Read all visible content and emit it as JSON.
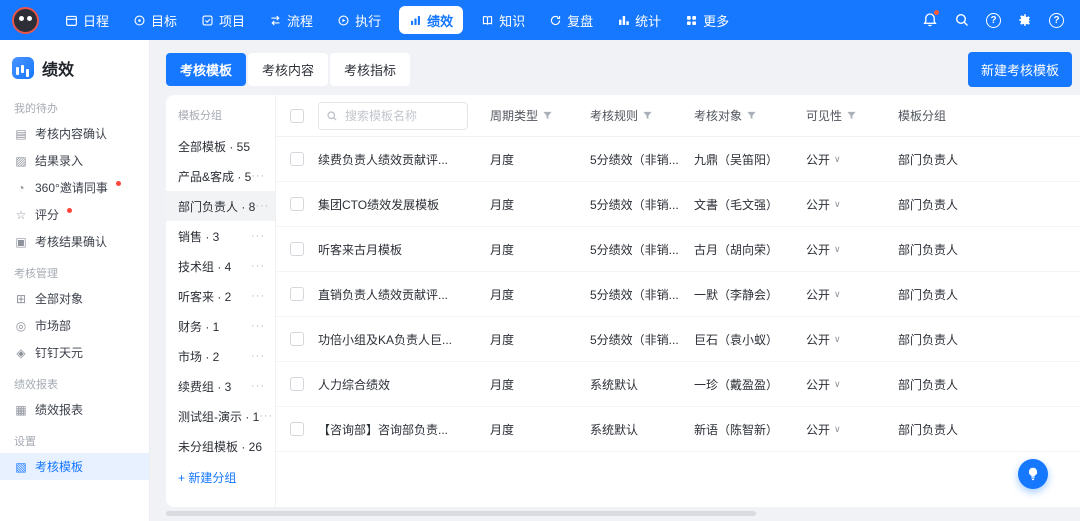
{
  "colors": {
    "accent": "#1677ff",
    "badge": "#ff4438"
  },
  "topbar": {
    "nav_items": [
      {
        "label": "日程",
        "icon": "calendar-icon"
      },
      {
        "label": "目标",
        "icon": "target-icon"
      },
      {
        "label": "项目",
        "icon": "project-icon"
      },
      {
        "label": "流程",
        "icon": "workflow-icon"
      },
      {
        "label": "执行",
        "icon": "execute-icon"
      },
      {
        "label": "绩效",
        "icon": "performance-icon",
        "active": true
      },
      {
        "label": "知识",
        "icon": "knowledge-icon"
      },
      {
        "label": "复盘",
        "icon": "review-icon"
      },
      {
        "label": "统计",
        "icon": "stats-icon"
      },
      {
        "label": "更多",
        "icon": "more-icon"
      }
    ],
    "right_icons": [
      "bell-icon",
      "search-icon",
      "help-icon",
      "settings-icon",
      "question-icon"
    ],
    "help_glyph": "?"
  },
  "sidebar": {
    "title": "绩效",
    "sections": [
      {
        "label": "我的待办",
        "items": [
          {
            "label": "考核内容确认",
            "glyph": "▤"
          },
          {
            "label": "结果录入",
            "glyph": "▨"
          },
          {
            "label": "360°邀请同事",
            "glyph": "◔",
            "dot": true
          },
          {
            "label": "评分",
            "glyph": "☆",
            "dot": true
          },
          {
            "label": "考核结果确认",
            "glyph": "▣"
          }
        ]
      },
      {
        "label": "考核管理",
        "items": [
          {
            "label": "全部对象",
            "glyph": "⊞"
          },
          {
            "label": "市场部",
            "glyph": "◎"
          },
          {
            "label": "钉钉天元",
            "glyph": "◈"
          }
        ]
      },
      {
        "label": "绩效报表",
        "items": [
          {
            "label": "绩效报表",
            "glyph": "▦"
          }
        ]
      },
      {
        "label": "设置",
        "items": [
          {
            "label": "考核模板",
            "glyph": "▧",
            "active": true
          }
        ]
      }
    ]
  },
  "main": {
    "tabs": [
      {
        "label": "考核模板",
        "active": true
      },
      {
        "label": "考核内容"
      },
      {
        "label": "考核指标"
      }
    ],
    "new_template_button": "新建考核模板",
    "groups": {
      "title": "模板分组",
      "more_glyph": "···",
      "new_group": "+ 新建分组",
      "items": [
        {
          "label": "全部模板 · 55"
        },
        {
          "label": "产品&客成 · 5",
          "more": true
        },
        {
          "label": "部门负责人 · 8",
          "more": true,
          "selected": true
        },
        {
          "label": "销售 · 3",
          "more": true
        },
        {
          "label": "技术组 · 4",
          "more": true
        },
        {
          "label": "听客来 · 2",
          "more": true
        },
        {
          "label": "财务 · 1",
          "more": true
        },
        {
          "label": "市场 · 2",
          "more": true
        },
        {
          "label": "续费组 · 3",
          "more": true
        },
        {
          "label": "测试组-演示 · 1",
          "more": true
        },
        {
          "label": "未分组模板 · 26"
        }
      ]
    },
    "table": {
      "search_placeholder": "搜索模板名称",
      "columns": [
        "周期类型",
        "考核规则",
        "考核对象",
        "可见性",
        "模板分组"
      ],
      "visibility_caret": "∨",
      "rows": [
        {
          "name": "续费负责人绩效贡献评...",
          "cycle": "月度",
          "rule": "5分绩效（非销...",
          "target": "九鼎（吴笛阳）",
          "visibility": "公开",
          "group": "部门负责人"
        },
        {
          "name": "集团CTO绩效发展模板",
          "cycle": "月度",
          "rule": "5分绩效（非销...",
          "target": "文書（毛文强）",
          "visibility": "公开",
          "group": "部门负责人"
        },
        {
          "name": "听客来古月模板",
          "cycle": "月度",
          "rule": "5分绩效（非销...",
          "target": "古月（胡向荣）",
          "visibility": "公开",
          "group": "部门负责人"
        },
        {
          "name": "直销负责人绩效贡献评...",
          "cycle": "月度",
          "rule": "5分绩效（非销...",
          "target": "一默（李静会）",
          "visibility": "公开",
          "group": "部门负责人"
        },
        {
          "name": "功倍小组及KA负责人巨...",
          "cycle": "月度",
          "rule": "5分绩效（非销...",
          "target": "巨石（袁小蚁）",
          "visibility": "公开",
          "group": "部门负责人"
        },
        {
          "name": "人力综合绩效",
          "cycle": "月度",
          "rule": "系统默认",
          "target": "一珍（戴盈盈）",
          "visibility": "公开",
          "group": "部门负责人"
        },
        {
          "name": "【咨询部】咨询部负责...",
          "cycle": "月度",
          "rule": "系统默认",
          "target": "新语（陈智新）",
          "visibility": "公开",
          "group": "部门负责人"
        }
      ]
    }
  }
}
